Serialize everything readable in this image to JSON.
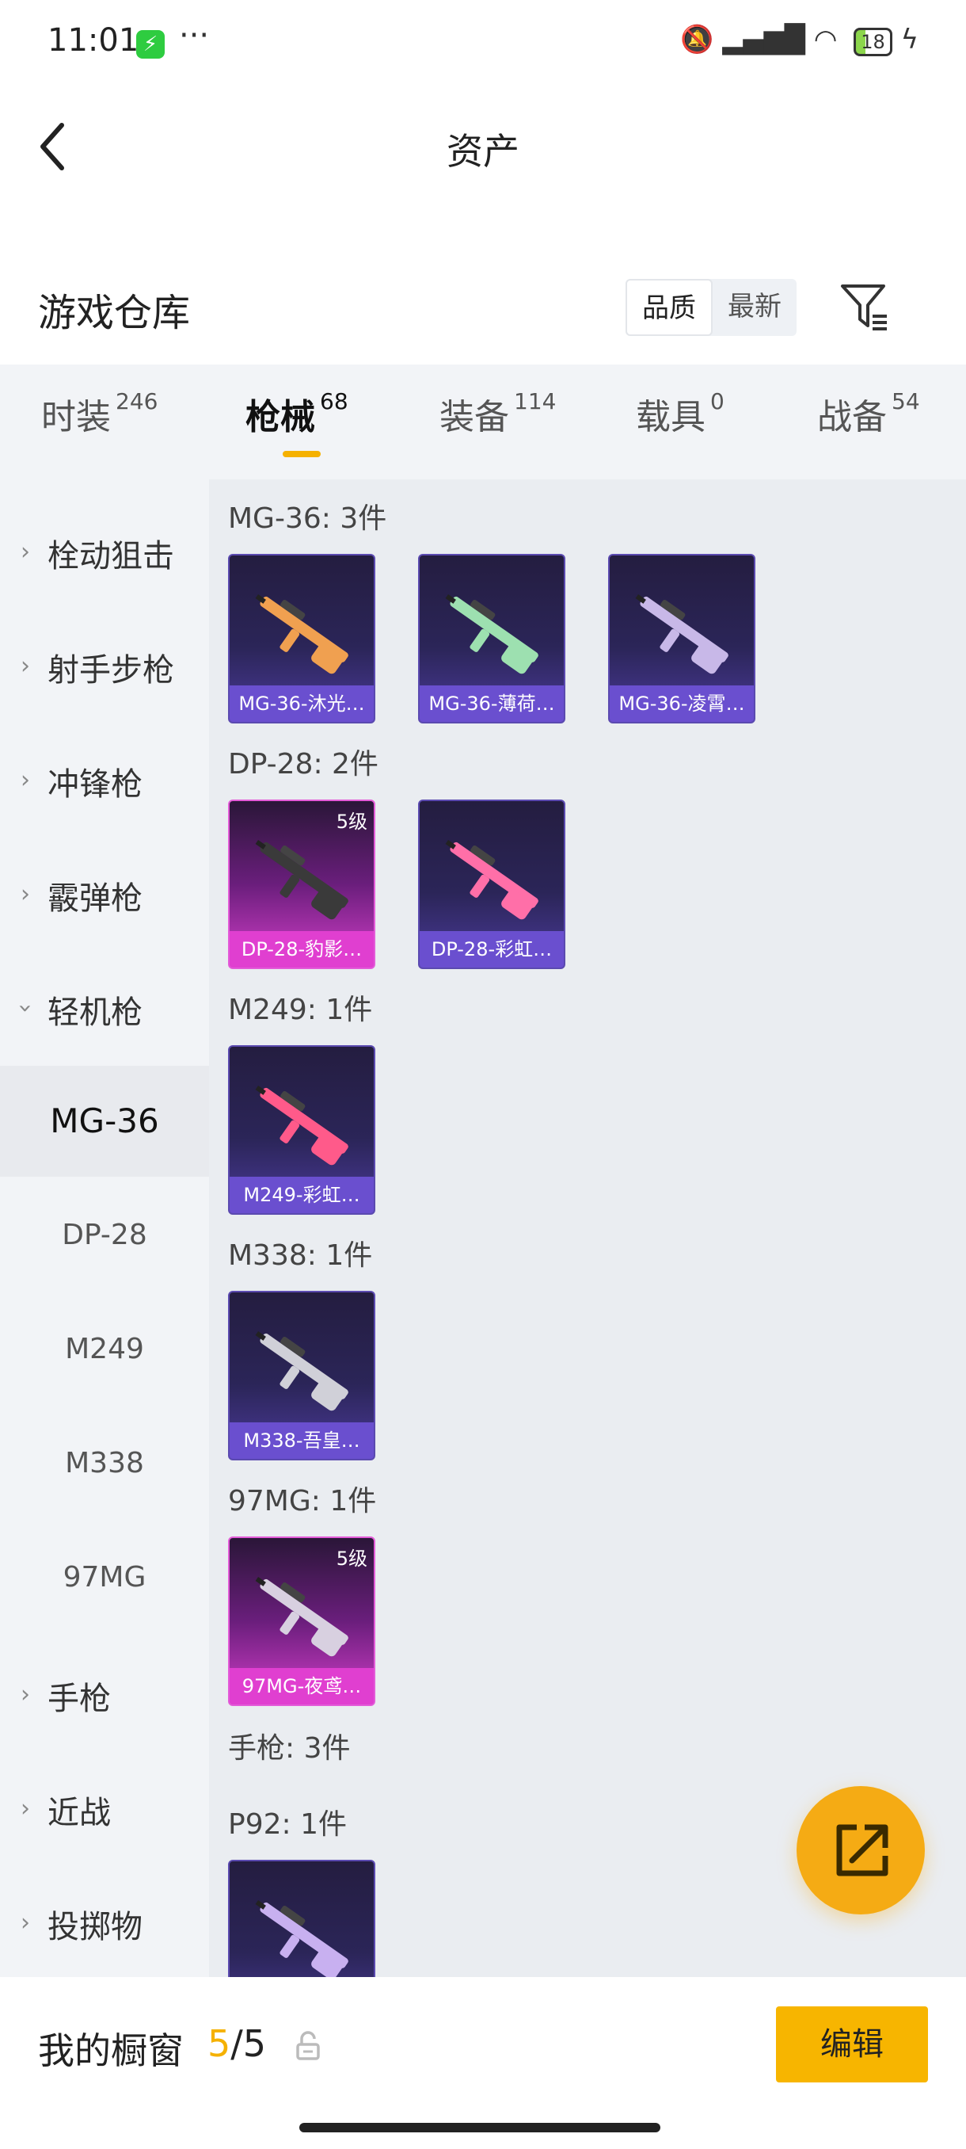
{
  "status_bar": {
    "time": "11:01",
    "battery": "18",
    "dots": "···",
    "charge": "⚡"
  },
  "header": {
    "title": "资产"
  },
  "section": {
    "title": "游戏仓库",
    "sort_options": [
      "品质",
      "最新"
    ],
    "sort_selected": "品质"
  },
  "tabs": [
    {
      "label": "时装",
      "count": "246"
    },
    {
      "label": "枪械",
      "count": "68",
      "active": true
    },
    {
      "label": "装备",
      "count": "114"
    },
    {
      "label": "载具",
      "count": "0"
    },
    {
      "label": "战备",
      "count": "54"
    }
  ],
  "sidebar": {
    "categories": [
      {
        "label": "栓动狙击",
        "expanded": false
      },
      {
        "label": "射手步枪",
        "expanded": false
      },
      {
        "label": "冲锋枪",
        "expanded": false
      },
      {
        "label": "霰弹枪",
        "expanded": false
      },
      {
        "label": "轻机枪",
        "expanded": true
      },
      {
        "label": "手枪",
        "expanded": false
      },
      {
        "label": "近战",
        "expanded": false
      },
      {
        "label": "投掷物",
        "expanded": false
      }
    ],
    "subcategories": [
      {
        "label": "MG-36",
        "active": true
      },
      {
        "label": "DP-28"
      },
      {
        "label": "M249"
      },
      {
        "label": "M338"
      },
      {
        "label": "97MG"
      }
    ]
  },
  "groups": [
    {
      "label": "MG-36: 3件",
      "items": [
        {
          "name": "MG-36-沐光…",
          "quality": "purple",
          "gun_color": "#f0a050"
        },
        {
          "name": "MG-36-薄荷…",
          "quality": "purple",
          "gun_color": "#9de0b0"
        },
        {
          "name": "MG-36-凌霄…",
          "quality": "purple",
          "gun_color": "#c8b8e8"
        }
      ]
    },
    {
      "label": "DP-28: 2件",
      "items": [
        {
          "name": "DP-28-豹影…",
          "quality": "pink",
          "level": "5级",
          "gun_color": "#3a3a3a"
        },
        {
          "name": "DP-28-彩虹…",
          "quality": "purple",
          "gun_color": "#ff6fa8"
        }
      ]
    },
    {
      "label": "M249: 1件",
      "items": [
        {
          "name": "M249-彩虹…",
          "quality": "purple",
          "gun_color": "#ff5a8a"
        }
      ]
    },
    {
      "label": "M338: 1件",
      "items": [
        {
          "name": "M338-吾皇…",
          "quality": "purple",
          "gun_color": "#d0d0d8"
        }
      ]
    },
    {
      "label": "97MG: 1件",
      "items": [
        {
          "name": "97MG-夜鸢…",
          "quality": "pink",
          "level": "5级",
          "gun_color": "#d8d0e0"
        }
      ]
    }
  ],
  "pistol_header": "手枪: 3件",
  "p92_group": {
    "label": "P92: 1件",
    "gun_color": "#c8b0f0"
  },
  "bottom_bar": {
    "label": "我的橱窗",
    "count_current": "5",
    "count_sep": "/",
    "count_total": "5",
    "edit_label": "编辑"
  },
  "colors": {
    "accent": "#f5b100",
    "fab": "#f5ab14"
  }
}
